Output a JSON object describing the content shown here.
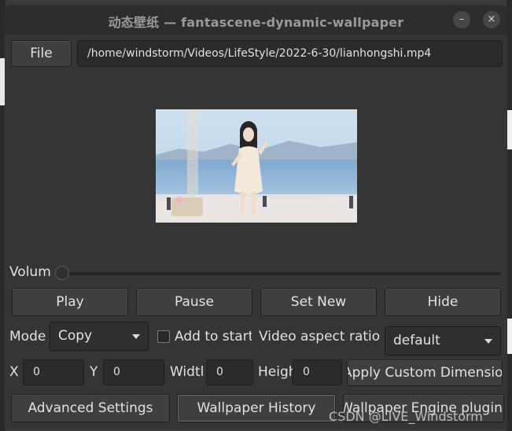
{
  "window": {
    "title": "动态壁纸 — fantascene-dynamic-wallpaper",
    "minimize_label": "–",
    "close_label": "×"
  },
  "file": {
    "button_label": "File",
    "path": "/home/windstorm/Videos/LifeStyle/2022-6-30/lianhongshi.mp4"
  },
  "volume": {
    "label": "Volum",
    "level": 0
  },
  "controls": {
    "play_label": "Play",
    "pause_label": "Pause",
    "set_new_label": "Set New",
    "hide_label": "Hide"
  },
  "mode": {
    "label": "Mode",
    "selected": "Copy",
    "add_to_startup_label": "Add to startu",
    "add_to_startup_checked": false
  },
  "aspect": {
    "label": "Video aspect ratio",
    "selected": "default"
  },
  "dimensions": {
    "x_label": "X",
    "x_value": "0",
    "y_label": "Y",
    "y_value": "0",
    "width_label": "Widtl",
    "width_value": "0",
    "height_label": "Heigh",
    "height_value": "0",
    "apply_label": "Apply Custom Dimension"
  },
  "bottom": {
    "advanced_label": "Advanced Settings",
    "history_label": "Wallpaper History",
    "wpe_label": "Wallpaper Engine plugin"
  },
  "watermark": "CSDN @LIVE_Windstorm"
}
